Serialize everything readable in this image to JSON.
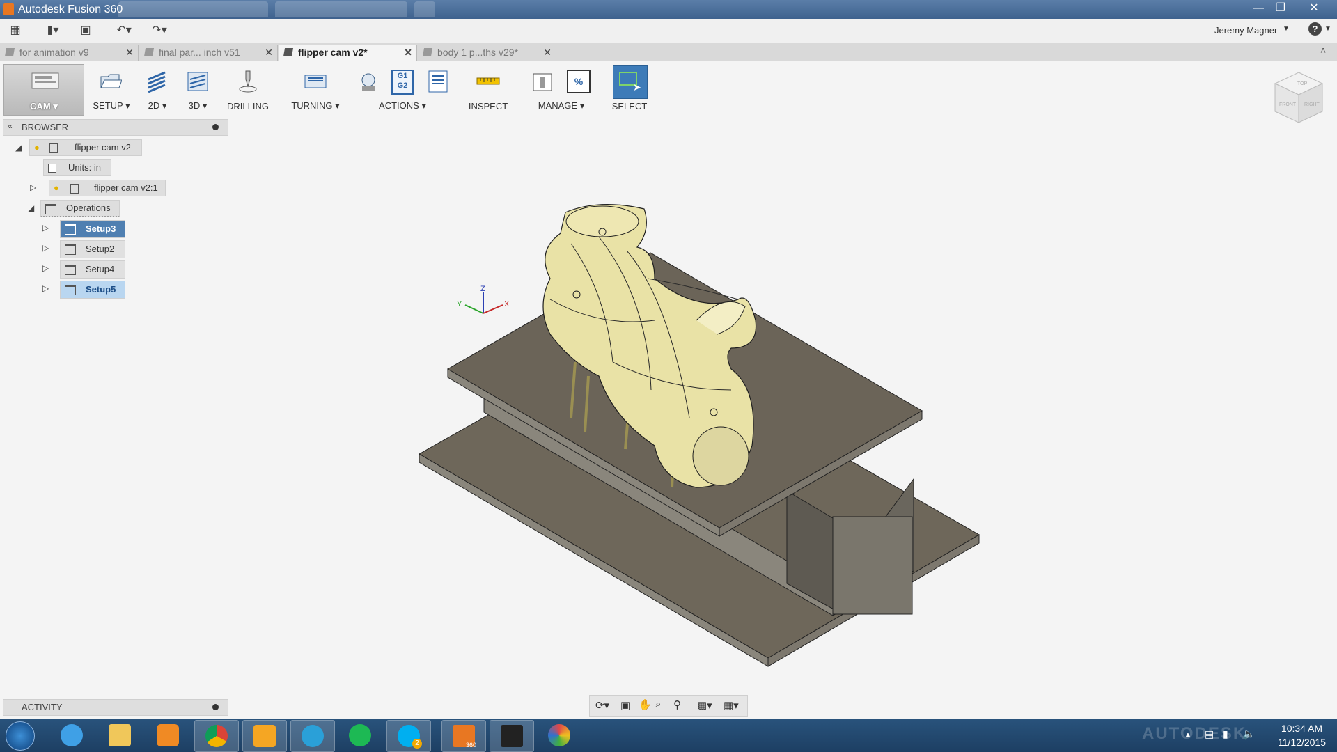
{
  "window": {
    "title": "Autodesk Fusion 360",
    "minimize_icon": "minimize-icon",
    "maximize_icon": "restore-icon",
    "close_icon": "close-icon"
  },
  "quick_access": {
    "user_name": "Jeremy Magner",
    "help_icon": "help-icon"
  },
  "doc_tabs": [
    {
      "label": "for animation v9",
      "active": false
    },
    {
      "label": "final par... inch v51",
      "active": false
    },
    {
      "label": "flipper cam v2*",
      "active": true
    },
    {
      "label": "body 1 p...ths v29*",
      "active": false
    }
  ],
  "toolbar": {
    "workspace": "CAM",
    "groups": [
      "SETUP",
      "2D",
      "3D",
      "DRILLING",
      "TURNING",
      "ACTIONS",
      "INSPECT",
      "MANAGE",
      "SELECT"
    ],
    "post_icon_text": "G1 G2",
    "percent_icon_text": "%"
  },
  "viewcube": {
    "top": "TOP",
    "front": "FRONT",
    "right": "RIGHT"
  },
  "browser": {
    "title": "BROWSER",
    "root": "flipper cam v2",
    "units": "Units: in",
    "component": "flipper cam v2:1",
    "operations": "Operations",
    "setups": [
      "Setup3",
      "Setup2",
      "Setup4",
      "Setup5"
    ]
  },
  "axes": {
    "x": "X",
    "y": "Y",
    "z": "Z"
  },
  "activity": {
    "title": "ACTIVITY"
  },
  "taskbar": {
    "apps": [
      "windows-start",
      "internet-explorer",
      "file-explorer",
      "media-player",
      "chrome",
      "outlook",
      "skype-for-business",
      "spotify",
      "skype",
      "fusion-360",
      "inkscape-app",
      "paint"
    ],
    "skype_badge": "2",
    "fusion_label": "360",
    "watermark": "AUTODESK",
    "time": "10:34 AM",
    "date": "11/12/2015"
  },
  "colors": {
    "selected_setup": "#4f7fb1",
    "select_tool": "#3d7bb8",
    "title_bar": "#3e628e",
    "taskbar": "#1d3f63",
    "stock_plate": "#6e675a",
    "part": "#e9e2a6"
  }
}
